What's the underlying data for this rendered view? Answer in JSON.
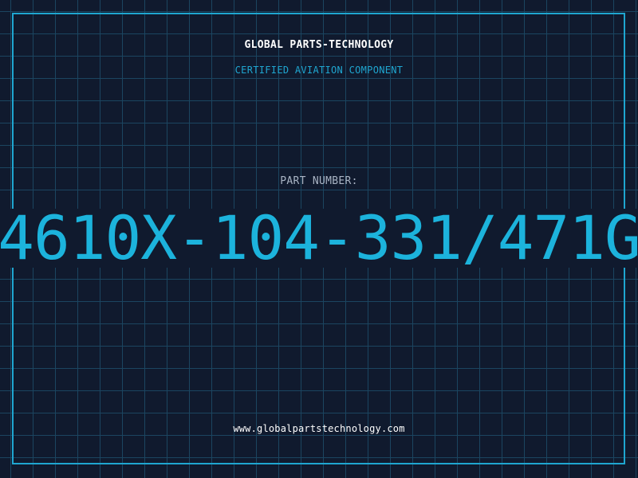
{
  "company": "GLOBAL PARTS-TECHNOLOGY",
  "subtitle": "CERTIFIED AVIATION COMPONENT",
  "part_label": "PART NUMBER:",
  "part_number": "4610X-104-331/471G",
  "website": "www.globalpartstechnology.com",
  "colors": {
    "background": "#101a2e",
    "grid": "#1b4560",
    "accent": "#1fa6d0",
    "part_number": "#1cb3dc"
  }
}
